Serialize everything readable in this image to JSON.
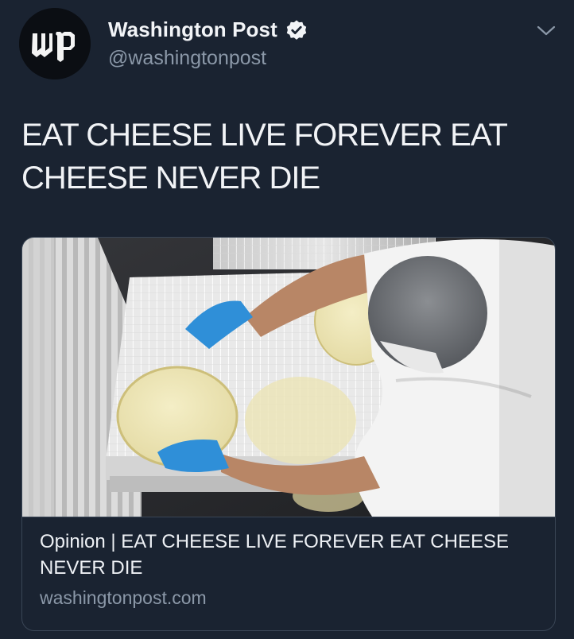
{
  "account": {
    "display_name": "Washington Post",
    "handle": "@washingtonpost",
    "avatar_icon": "washington-post-logo-icon",
    "verified_icon": "verified-badge-icon"
  },
  "tweet": {
    "text": "EAT CHEESE LIVE FOREVER EAT CHEESE NEVER DIE"
  },
  "card": {
    "title": "Opinion | EAT CHEESE LIVE FOREVER EAT CHEESE NEVER DIE",
    "domain": "washingtonpost.com"
  },
  "menu_icon": "chevron-down-icon",
  "colors": {
    "background": "#1a2331",
    "handle_gray": "#8b98a8",
    "border": "#3a4656"
  }
}
